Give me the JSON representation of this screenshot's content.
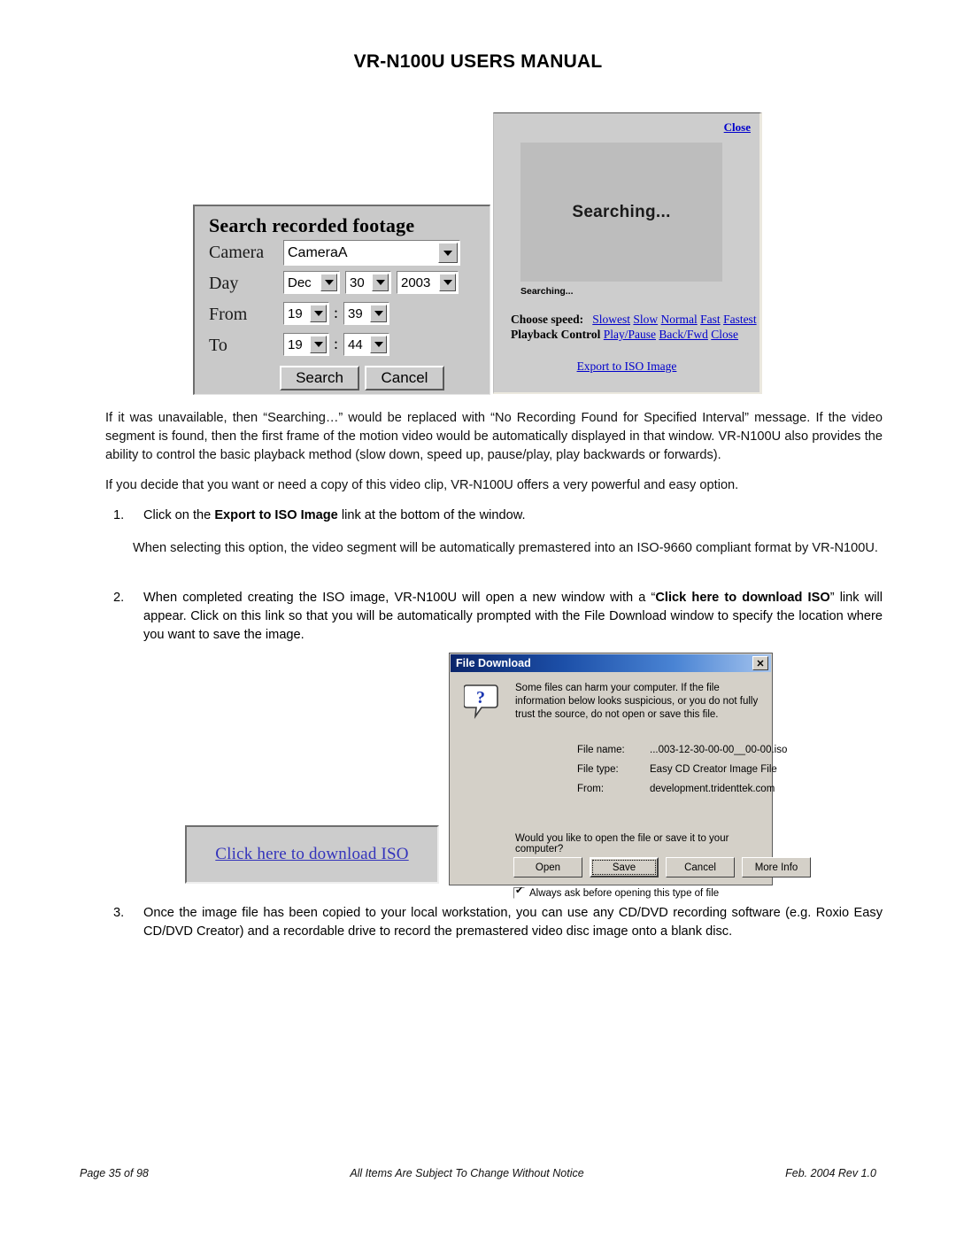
{
  "header": {
    "title": "VR-N100U USERS MANUAL"
  },
  "search_figure": {
    "title": "Search recorded footage",
    "labels": {
      "camera": "Camera",
      "day": "Day",
      "from": "From",
      "to": "To"
    },
    "camera_value": "CameraA",
    "month_value": "Dec",
    "day_value": "30",
    "year_value": "2003",
    "from_hour": "19",
    "from_minute": "39",
    "to_hour": "19",
    "to_minute": "44",
    "time_separator": ":",
    "search_button": "Search",
    "cancel_button": "Cancel"
  },
  "searching_figure": {
    "close_link": "Close",
    "video_text": "Searching...",
    "status_text": "Searching...",
    "speed_label": "Choose speed:",
    "speed_links": [
      "Slowest",
      "Slow",
      "Normal",
      "Fast",
      "Fastest"
    ],
    "playback_label": "Playback Control",
    "playback_links": [
      "Play/Pause",
      "Back/Fwd",
      "Close"
    ],
    "export_link": "Export to ISO Image"
  },
  "download_link_figure": {
    "link_text": "Click here to download ISO"
  },
  "file_download_dialog": {
    "title": "File Download",
    "close_glyph": "✕",
    "warning": "Some files can harm your computer. If the file information below looks suspicious, or you do not fully trust the source, do not open or save this file.",
    "fields": [
      {
        "key": "File name:",
        "value": "...003-12-30-00-00__00-00.iso"
      },
      {
        "key": "File type:",
        "value": "Easy CD Creator Image File"
      },
      {
        "key": "From:",
        "value": "development.tridenttek.com"
      }
    ],
    "question": "Would you like to open the file or save it to your computer?",
    "buttons": [
      {
        "label": "Open",
        "accel": "O"
      },
      {
        "label": "Save",
        "accel": "S"
      },
      {
        "label": "Cancel",
        "accel": ""
      },
      {
        "label": "More Info",
        "accel": "M"
      }
    ],
    "checkbox_label": "Always ask before opening this type of file",
    "checkbox_checked": true
  },
  "body": {
    "paragraph_1": "If it was unavailable, then “Searching…” would be replaced with “No Recording Found for Specified Interval” message. If the video segment is found, then the first frame of the motion video would be automatically displayed in that window. VR-N100U also provides the ability to control the basic playback method (slow down, speed up, pause/play, play backwards or forwards).",
    "paragraph_2": "If you decide that you want or need a copy of this video clip, VR-N100U offers a very powerful and easy option.",
    "item_1_number": "1.",
    "item_1_pre": "Click on the ",
    "item_1_bold": "Export to ISO Image",
    "item_1_post": " link at the bottom of the window.",
    "paragraph_3": "When selecting this option, the video segment will be automatically premastered into an ISO-9660 compliant format by VR-N100U.",
    "item_2_number": "2.",
    "item_2_pre": "When completed creating the ISO image, VR-N100U will open a new window with a “",
    "item_2_bold": "Click here to download ISO",
    "item_2_post": "” link will appear. Click on this link so that you will be automatically prompted with the File Download window to specify the location where you want to save the image.",
    "item_3_number": "3.",
    "item_3_text": "Once the image file has been copied to your local workstation, you can use any CD/DVD recording software (e.g. Roxio Easy CD/DVD Creator) and a recordable drive to record the premastered video disc image onto a blank disc."
  },
  "footer": {
    "left": "Page 35 of 98",
    "center": "All Items Are Subject To Change Without Notice",
    "right": "Feb. 2004 Rev 1.0"
  },
  "colors": {
    "link": "#0000cc",
    "dialog_face": "#d4d0c8",
    "titlebar_start": "#0a246a",
    "titlebar_end": "#a5c4ee"
  }
}
